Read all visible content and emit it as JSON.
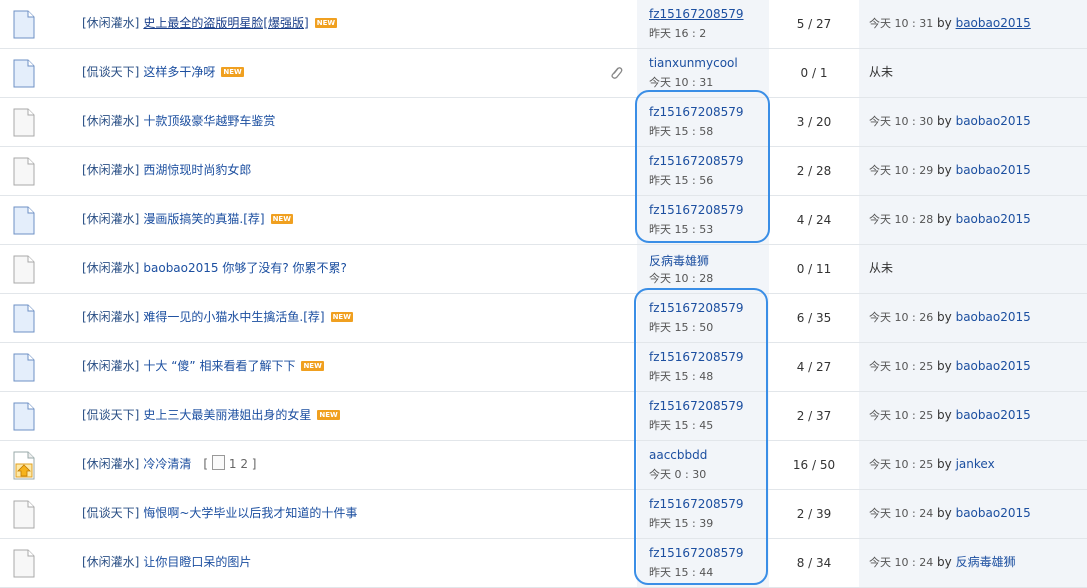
{
  "threads": [
    {
      "icon": "doc-blue-icon",
      "tag": "[休闲灌水]",
      "title": "史上最全的盗版明星脸[爆强版]",
      "title_underline": true,
      "new_badge": "NEW",
      "attachment": false,
      "pages": null,
      "author": "fz15167208579",
      "author_underline": true,
      "post_date": "昨天  16 : 2",
      "counts": "5 / 27",
      "last_time": "今天  10 : 31",
      "by": "by",
      "last_user": "baobao2015",
      "last_user_underline": true
    },
    {
      "icon": "doc-blue-icon",
      "tag": "[侃谈天下]",
      "title": "这样多干净呀",
      "title_underline": false,
      "new_badge": "NEW",
      "attachment": true,
      "pages": null,
      "author": "tianxunmycool",
      "author_underline": false,
      "post_date": "今天  10 : 31",
      "counts": "0 / 1",
      "last_time": "从未",
      "by": "",
      "last_user": "",
      "last_user_underline": false
    },
    {
      "icon": "doc-gray-icon",
      "tag": "[休闲灌水]",
      "title": "十款顶级豪华越野车鉴赏",
      "title_underline": false,
      "new_badge": "",
      "attachment": false,
      "pages": null,
      "author": "fz15167208579",
      "author_underline": false,
      "post_date": "昨天  15 : 58",
      "counts": "3 / 20",
      "last_time": "今天  10 : 30",
      "by": "by",
      "last_user": "baobao2015",
      "last_user_underline": false
    },
    {
      "icon": "doc-gray-icon",
      "tag": "[休闲灌水]",
      "title": "西湖惊现时尚豹女郎",
      "title_underline": false,
      "new_badge": "",
      "attachment": false,
      "pages": null,
      "author": "fz15167208579",
      "author_underline": false,
      "post_date": "昨天  15 : 56",
      "counts": "2 / 28",
      "last_time": "今天  10 : 29",
      "by": "by",
      "last_user": "baobao2015",
      "last_user_underline": false
    },
    {
      "icon": "doc-blue-icon",
      "tag": "[休闲灌水]",
      "title": "漫画版搞笑的真猫.[荐]",
      "title_underline": false,
      "new_badge": "NEW",
      "attachment": false,
      "pages": null,
      "author": "fz15167208579",
      "author_underline": false,
      "post_date": "昨天  15 : 53",
      "counts": "4 / 24",
      "last_time": "今天  10 : 28",
      "by": "by",
      "last_user": "baobao2015",
      "last_user_underline": false
    },
    {
      "icon": "doc-gray-icon",
      "tag": "[休闲灌水]",
      "title": "baobao2015 你够了没有? 你累不累?",
      "title_underline": false,
      "new_badge": "",
      "attachment": false,
      "pages": null,
      "author": "反病毒雄狮",
      "author_underline": false,
      "post_date": "今天  10 : 28",
      "counts": "0 / 11",
      "last_time": "从未",
      "by": "",
      "last_user": "",
      "last_user_underline": false
    },
    {
      "icon": "doc-blue-icon",
      "tag": "[休闲灌水]",
      "title": "难得一见的小猫水中生擒活鱼.[荐]",
      "title_underline": false,
      "new_badge": "NEW",
      "attachment": false,
      "pages": null,
      "author": "fz15167208579",
      "author_underline": false,
      "post_date": "昨天  15 : 50",
      "counts": "6 / 35",
      "last_time": "今天  10 : 26",
      "by": "by",
      "last_user": "baobao2015",
      "last_user_underline": false
    },
    {
      "icon": "doc-blue-icon",
      "tag": "[休闲灌水]",
      "title": "十大 “傻” 相来看看了解下下",
      "title_underline": false,
      "new_badge": "NEW",
      "attachment": false,
      "pages": null,
      "author": "fz15167208579",
      "author_underline": false,
      "post_date": "昨天  15 : 48",
      "counts": "4 / 27",
      "last_time": "今天  10 : 25",
      "by": "by",
      "last_user": "baobao2015",
      "last_user_underline": false
    },
    {
      "icon": "doc-blue-icon",
      "tag": "[侃谈天下]",
      "title": "史上三大最美丽港姐出身的女星",
      "title_underline": false,
      "new_badge": "NEW",
      "attachment": false,
      "pages": null,
      "author": "fz15167208579",
      "author_underline": false,
      "post_date": "昨天  15 : 45",
      "counts": "2 / 37",
      "last_time": "今天  10 : 25",
      "by": "by",
      "last_user": "baobao2015",
      "last_user_underline": false
    },
    {
      "icon": "hot-thread-icon",
      "tag": "[休闲灌水]",
      "title": "冷冷清清",
      "title_underline": false,
      "new_badge": "",
      "attachment": false,
      "pages": "1 2 ]",
      "author": "aaccbbdd",
      "author_underline": false,
      "post_date": "今天  0 : 30",
      "counts": "16 / 50",
      "last_time": "今天  10 : 25",
      "by": "by",
      "last_user": "jankex",
      "last_user_underline": false
    },
    {
      "icon": "doc-gray-icon",
      "tag": "[侃谈天下]",
      "title": "悔恨啊~大学毕业以后我才知道的十件事",
      "title_underline": false,
      "new_badge": "",
      "attachment": false,
      "pages": null,
      "author": "fz15167208579",
      "author_underline": false,
      "post_date": "昨天  15 : 39",
      "counts": "2 / 39",
      "last_time": "今天  10 : 24",
      "by": "by",
      "last_user": "baobao2015",
      "last_user_underline": false
    },
    {
      "icon": "doc-gray-icon",
      "tag": "[休闲灌水]",
      "title": "让你目瞪口呆的图片",
      "title_underline": false,
      "new_badge": "",
      "attachment": false,
      "pages": null,
      "author": "fz15167208579",
      "author_underline": false,
      "post_date": "昨天  15 : 44",
      "counts": "8 / 34",
      "last_time": "今天  10 : 24",
      "by": "by",
      "last_user": "反病毒雄狮",
      "last_user_underline": false
    }
  ],
  "colors": {
    "row_alt": "#f2f5f9",
    "link": "#1c4fa0",
    "highlight": "#3a8ee6",
    "new_badge": "#f0a020"
  }
}
